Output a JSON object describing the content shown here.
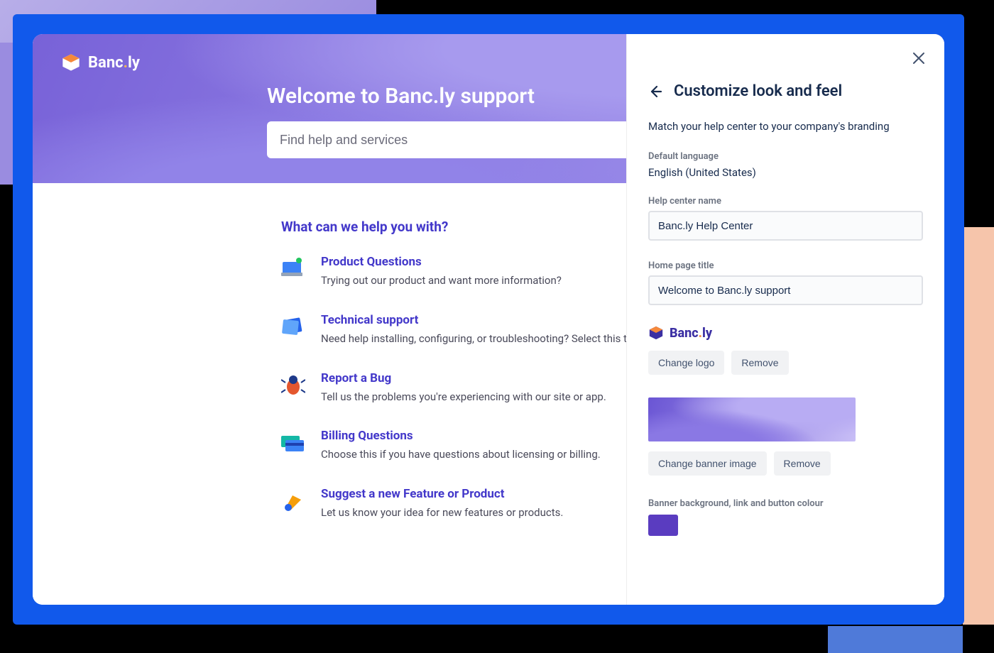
{
  "brand": {
    "name": "Banc",
    "suffix": "ly"
  },
  "hero": {
    "title": "Welcome to Banc.ly support",
    "search_placeholder": "Find help and services"
  },
  "content": {
    "heading": "What can we help you with?",
    "topics": [
      {
        "icon": "monitor-icon",
        "title": "Product Questions",
        "desc": "Trying out our product and want more information?"
      },
      {
        "icon": "folder-icon",
        "title": "Technical support",
        "desc": "Need help installing, configuring, or troubleshooting? Select this to…"
      },
      {
        "icon": "bug-icon",
        "title": "Report a Bug",
        "desc": "Tell us the problems you're experiencing with our site or app."
      },
      {
        "icon": "credit-card-icon",
        "title": "Billing Questions",
        "desc": "Choose this if you have questions about licensing or billing."
      },
      {
        "icon": "megaphone-icon",
        "title": "Suggest a new Feature or Product",
        "desc": "Let us know your idea for new features or products."
      }
    ]
  },
  "panel": {
    "title": "Customize look and feel",
    "subtitle": "Match your help center to your company's branding",
    "default_language_label": "Default language",
    "default_language_value": "English (United States)",
    "help_center_name_label": "Help center name",
    "help_center_name_value": "Banc.ly Help Center",
    "home_page_title_label": "Home page title",
    "home_page_title_value": "Welcome to Banc.ly support",
    "change_logo": "Change logo",
    "remove_logo": "Remove",
    "change_banner": "Change banner image",
    "remove_banner": "Remove",
    "banner_color_label": "Banner background, link and button colour",
    "banner_color_value": "#5a3cc0"
  }
}
